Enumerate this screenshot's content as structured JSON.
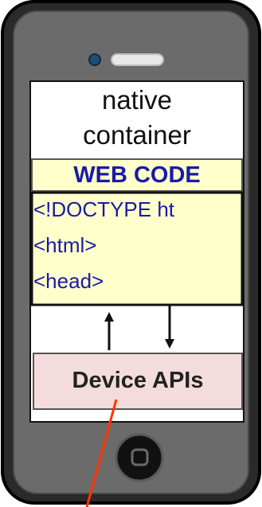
{
  "diagram": {
    "native_container": {
      "line1": "native",
      "line2": "container"
    },
    "web_code": {
      "title": "WEB CODE",
      "code_lines": [
        "<!DOCTYPE ht",
        "<html>",
        "<head>"
      ]
    },
    "device_apis": {
      "label": "Device APIs"
    }
  },
  "colors": {
    "phone_body": "#2a2a2a",
    "web_code_fill": "#ffffcc",
    "web_code_text": "#1a1aa6",
    "device_apis_fill": "#f5dcdc",
    "pointer_line": "#ff3300"
  }
}
